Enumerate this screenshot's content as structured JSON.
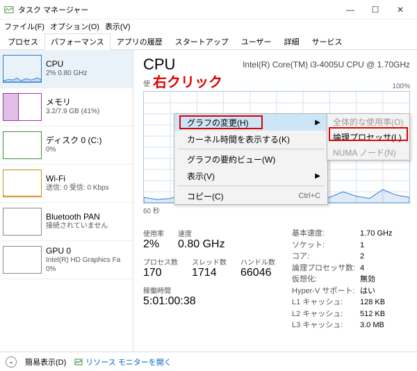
{
  "window": {
    "title": "タスク マネージャー"
  },
  "menu": {
    "file": "ファイル(F)",
    "options": "オプション(O)",
    "view": "表示(V)"
  },
  "tabs": {
    "processes": "プロセス",
    "performance": "パフォーマンス",
    "history": "アプリの履歴",
    "startup": "スタートアップ",
    "users": "ユーザー",
    "details": "詳細",
    "services": "サービス"
  },
  "sidebar": {
    "cpu": {
      "name": "CPU",
      "sub": "2%  0.80 GHz"
    },
    "mem": {
      "name": "メモリ",
      "sub": "3.2/7.9 GB (41%)"
    },
    "disk": {
      "name": "ディスク 0 (C:)",
      "sub": "0%"
    },
    "wifi": {
      "name": "Wi-Fi",
      "sub": "送信: 0  受信: 0 Kbps"
    },
    "bt": {
      "name": "Bluetooth PAN",
      "sub": "接続されていません"
    },
    "gpu": {
      "name": "GPU 0",
      "sub1": "Intel(R) HD Graphics Fa",
      "sub2": "0%"
    }
  },
  "main": {
    "title": "CPU",
    "model": "Intel(R) Core(TM) i3-4005U CPU @ 1.70GHz",
    "util_label_prefix": "使",
    "pct100": "100%",
    "sec60": "60 秒"
  },
  "annotation": "右クリック",
  "context": {
    "change_graph": "グラフの変更(H)",
    "show_kernel": "カーネル時間を表示する(K)",
    "summary": "グラフの要約ビュー(W)",
    "view": "表示(V)",
    "copy": "コピー(C)",
    "copy_shortcut": "Ctrl+C"
  },
  "submenu": {
    "overall": "全体的な使用率(O)",
    "logical": "論理プロセッサ(L)",
    "numa": "NUMA ノード(N)"
  },
  "stats": {
    "util_lbl": "使用率",
    "util": "2%",
    "speed_lbl": "速度",
    "speed": "0.80 GHz",
    "proc_lbl": "プロセス数",
    "proc": "170",
    "thread_lbl": "スレッド数",
    "thread": "1714",
    "handle_lbl": "ハンドル数",
    "handle": "66046",
    "uptime_lbl": "稼働時間",
    "uptime": "5:01:00:38"
  },
  "info": {
    "base_k": "基本速度:",
    "base_v": "1.70 GHz",
    "socket_k": "ソケット:",
    "socket_v": "1",
    "core_k": "コア:",
    "core_v": "2",
    "lp_k": "論理プロセッサ数:",
    "lp_v": "4",
    "virt_k": "仮想化:",
    "virt_v": "無効",
    "hv_k": "Hyper-V サポート:",
    "hv_v": "はい",
    "l1_k": "L1 キャッシュ:",
    "l1_v": "128 KB",
    "l2_k": "L2 キャッシュ:",
    "l2_v": "512 KB",
    "l3_k": "L3 キャッシュ:",
    "l3_v": "3.0 MB"
  },
  "footer": {
    "fewer": "簡易表示(D)",
    "resmon": "リソース モニターを開く"
  },
  "chart_data": {
    "type": "line",
    "title": "CPU 使用率",
    "ylabel": "% 使用率",
    "xlabel": "秒",
    "ylim": [
      0,
      100
    ],
    "xlim": [
      60,
      0
    ],
    "x": [
      60,
      57,
      54,
      51,
      48,
      45,
      42,
      39,
      36,
      33,
      30,
      27,
      24,
      21,
      18,
      15,
      12,
      9,
      6,
      3,
      0
    ],
    "values": [
      5,
      3,
      4,
      8,
      5,
      4,
      6,
      4,
      3,
      5,
      4,
      3,
      7,
      4,
      5,
      10,
      6,
      4,
      12,
      7,
      5
    ]
  }
}
